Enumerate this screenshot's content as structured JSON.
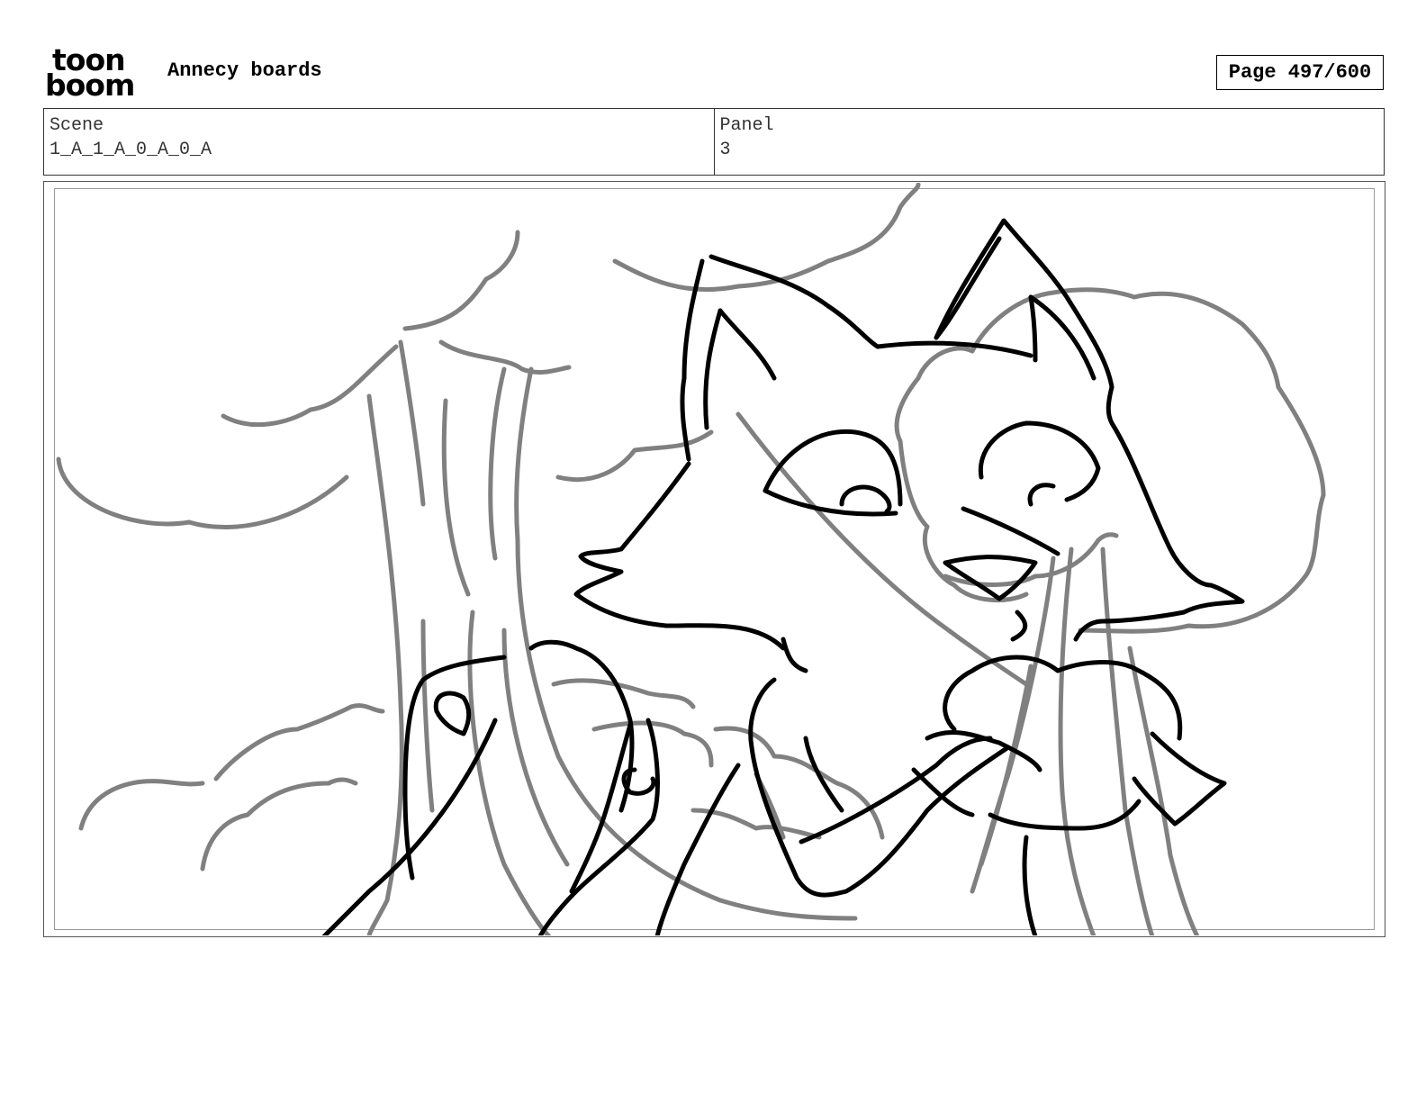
{
  "header": {
    "logo_top": "toon",
    "logo_bottom": "boom",
    "title": "Annecy boards",
    "page_label": "Page 497/600"
  },
  "info": {
    "scene_label": "Scene",
    "scene_value": "1_A_1_A_0_A_0_A",
    "panel_label": "Panel",
    "panel_value": "3"
  },
  "colors": {
    "ink": "#000000",
    "background_sketch": "#808080"
  }
}
